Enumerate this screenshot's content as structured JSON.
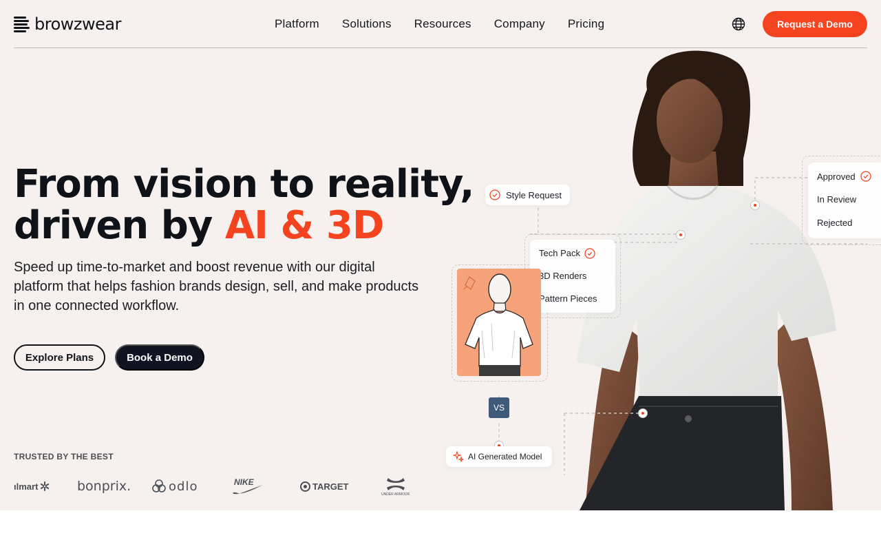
{
  "brand": {
    "name": "browzwear"
  },
  "nav": {
    "items": [
      "Platform",
      "Solutions",
      "Resources",
      "Company",
      "Pricing"
    ],
    "cta": "Request a Demo",
    "language_icon": "globe-icon"
  },
  "hero": {
    "headline_line1": "From vision to reality,",
    "headline_line2_prefix": "driven by ",
    "headline_line2_accent": "AI & 3D",
    "subtext": "Speed up time-to-market and boost revenue with our digital platform that helps fashion brands design, sell, and make products in one connected workflow.",
    "btn_explore": "Explore Plans",
    "btn_book": "Book a Demo",
    "trusted_label": "TRUSTED BY THE BEST",
    "brands": [
      "ılmart",
      "bonprix.",
      "odlo",
      "NIKE",
      "TARGET",
      "UNDER ARMOUR"
    ]
  },
  "workflow": {
    "style_request": "Style Request",
    "tech_pack": "Tech Pack",
    "renders": "3D Renders",
    "pattern": "Pattern Pieces",
    "vs_label": "VS",
    "ai_model": "AI Generated Model",
    "status": [
      "Approved",
      "In Review",
      "Rejected"
    ]
  },
  "colors": {
    "accent": "#f4431f",
    "dark": "#0f1420",
    "hero_bg": "#f6f1ef"
  }
}
